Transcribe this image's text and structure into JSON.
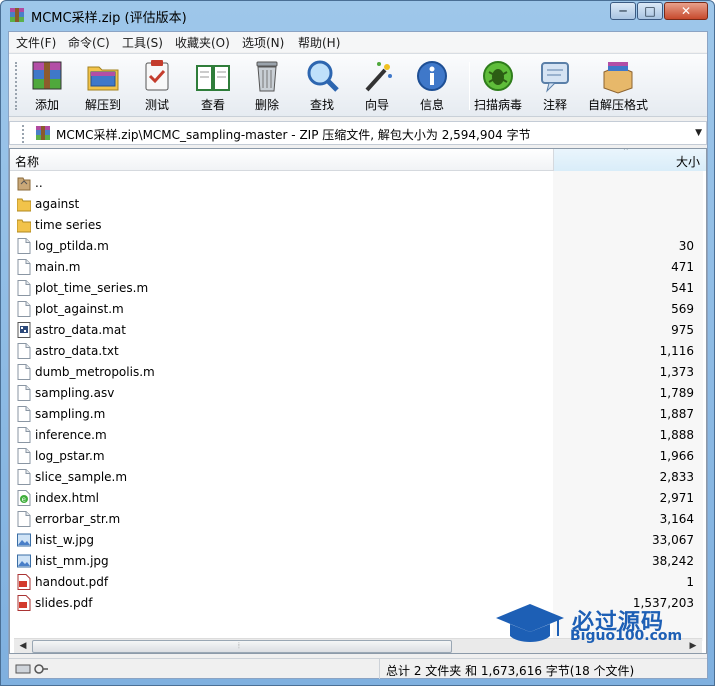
{
  "window": {
    "title": "MCMC采样.zip (评估版本)",
    "min_glyph": "─",
    "max_glyph": "□",
    "close_glyph": "✕"
  },
  "menu": [
    "文件(F)",
    "命令(C)",
    "工具(S)",
    "收藏夹(O)",
    "选项(N)",
    "帮助(H)"
  ],
  "toolbar": [
    {
      "label": "添加",
      "icon": "add-archive-icon"
    },
    {
      "label": "解压到",
      "icon": "extract-to-icon"
    },
    {
      "label": "测试",
      "icon": "test-icon"
    },
    {
      "label": "查看",
      "icon": "view-book-icon"
    },
    {
      "label": "删除",
      "icon": "trash-icon"
    },
    {
      "label": "查找",
      "icon": "magnifier-icon"
    },
    {
      "label": "向导",
      "icon": "wizard-wand-icon"
    },
    {
      "label": "信息",
      "icon": "info-icon"
    },
    {
      "label": "扫描病毒",
      "icon": "virus-scan-icon"
    },
    {
      "label": "注释",
      "icon": "comment-icon"
    },
    {
      "label": "自解压格式",
      "icon": "sfx-box-icon"
    }
  ],
  "path": {
    "text": "MCMC采样.zip\\MCMC_sampling-master - ZIP 压缩文件, 解包大小为 2,594,904 字节",
    "drop_glyph": "▼"
  },
  "columns": {
    "name": "名称",
    "size": "大小",
    "sort_glyph": "⌃"
  },
  "files": [
    {
      "name": "..",
      "size": "",
      "type": "parent"
    },
    {
      "name": "against",
      "size": "",
      "type": "folder"
    },
    {
      "name": "time series",
      "size": "",
      "type": "folder"
    },
    {
      "name": "log_ptilda.m",
      "size": "30",
      "type": "file"
    },
    {
      "name": "main.m",
      "size": "471",
      "type": "file"
    },
    {
      "name": "plot_time_series.m",
      "size": "541",
      "type": "file"
    },
    {
      "name": "plot_against.m",
      "size": "569",
      "type": "file"
    },
    {
      "name": "astro_data.mat",
      "size": "975",
      "type": "mat"
    },
    {
      "name": "astro_data.txt",
      "size": "1,116",
      "type": "file"
    },
    {
      "name": "dumb_metropolis.m",
      "size": "1,373",
      "type": "file"
    },
    {
      "name": "sampling.asv",
      "size": "1,789",
      "type": "file"
    },
    {
      "name": "sampling.m",
      "size": "1,887",
      "type": "file"
    },
    {
      "name": "inference.m",
      "size": "1,888",
      "type": "file"
    },
    {
      "name": "log_pstar.m",
      "size": "1,966",
      "type": "file"
    },
    {
      "name": "slice_sample.m",
      "size": "2,833",
      "type": "file"
    },
    {
      "name": "index.html",
      "size": "2,971",
      "type": "html"
    },
    {
      "name": "errorbar_str.m",
      "size": "3,164",
      "type": "file"
    },
    {
      "name": "hist_w.jpg",
      "size": "33,067",
      "type": "image"
    },
    {
      "name": "hist_mm.jpg",
      "size": "38,242",
      "type": "image"
    },
    {
      "name": "handout.pdf",
      "size": "1",
      "type": "pdf"
    },
    {
      "name": "slides.pdf",
      "size": "1,537,203",
      "type": "pdf"
    }
  ],
  "scrollbar": {
    "left_glyph": "◀",
    "right_glyph": "▶",
    "grip_glyph": "⦙"
  },
  "status": {
    "text": "总计 2 文件夹 和 1,673,616 字节(18 个文件)"
  },
  "watermark": {
    "cn": "必过源码",
    "en": "Biguo100.com"
  }
}
